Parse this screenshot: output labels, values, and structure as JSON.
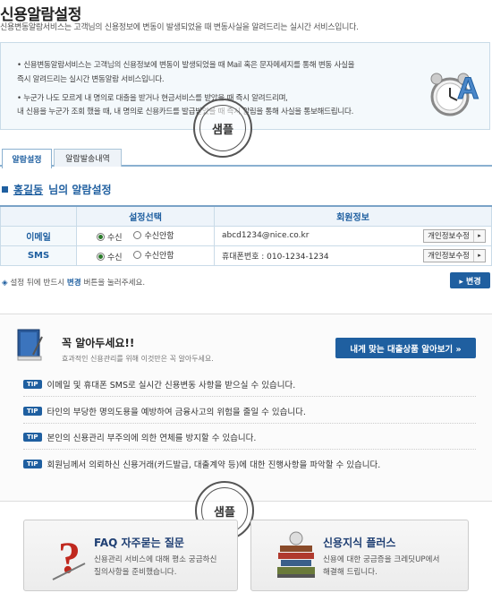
{
  "page": {
    "title": "신용알람설정",
    "subtitle": "신용변동알람서비스는 고객님의 신용정보에 변동이 발생되었을 때 변동사실을 알려드리는 실시간 서비스입니다."
  },
  "info_box": {
    "lines": [
      "• 신용변동알람서비스는 고객님의 신용정보에 변동이 발생되었을 때 Mail 혹은 문자메세지를 통해 변동 사실을",
      "  즉시 알려드리는 실시간 변동알람 서비스입니다.",
      "• 누군가 나도 모르게 내 명의로 대출을 받거나 현금서비스를 받았을 때 즉시 알려드리며,",
      "  내 신용을 누군가 조회 했을 때, 내 명의로 신용카드를 발급받았을 때 즉시 알림을 통해 사실을 통보해드립니다."
    ],
    "stamp_text": "샘플"
  },
  "tabs": [
    "알람설정",
    "알람발송내역"
  ],
  "section": {
    "user_name": "홍길동",
    "suffix": "님의 알람설정"
  },
  "table": {
    "headers": [
      "설정선택",
      "회원정보"
    ],
    "rows": [
      {
        "label": "이메일",
        "opt_on": "수신",
        "opt_off": "수신안함",
        "info": "abcd1234@nice.co.kr",
        "button": "개인정보수정"
      },
      {
        "label": "SMS",
        "opt_on": "수신",
        "opt_off": "수신안함",
        "info": "휴대폰번호 :   010-1234-1234",
        "button": "개인정보수정"
      }
    ]
  },
  "note": {
    "before": "설정 뒤에 반드시 ",
    "highlight": "변경",
    "after": " 버튼을 눌러주세요.",
    "change_button": "▸ 변경"
  },
  "tips": {
    "heading": "꼭 알아두세요!!",
    "subheading": "효과적인 신용관리를 위해 이것만은 꼭 알아두세요.",
    "loan_button": "내게 맞는 대출상품 알아보기  »",
    "badge": "TIP",
    "items": [
      "이메일 및 휴대폰 SMS로 실시간 신용변동 사항을 받으실 수 있습니다.",
      "타인의 부당한 명의도용을 예방하여 금융사고의 위험을 줄일 수 있습니다.",
      "본인의 신용관리 부주의에 의한 연체를 방지할 수 있습니다.",
      "회원님께서 의뢰하신 신용거래(카드발급, 대출계약 등)에 대한 진행사항을 파악할 수 있습니다."
    ],
    "stamp_text": "샘플"
  },
  "cards": [
    {
      "title": "FAQ 자주묻는 질문",
      "desc1": "신용관리 서비스에 대해 평소 궁금하신",
      "desc2": "질의사항을 준비했습니다."
    },
    {
      "title": "신용지식 플러스",
      "desc1": "신용에 대한 궁금증을 크레딧UP에서",
      "desc2": "해결해 드립니다."
    }
  ]
}
